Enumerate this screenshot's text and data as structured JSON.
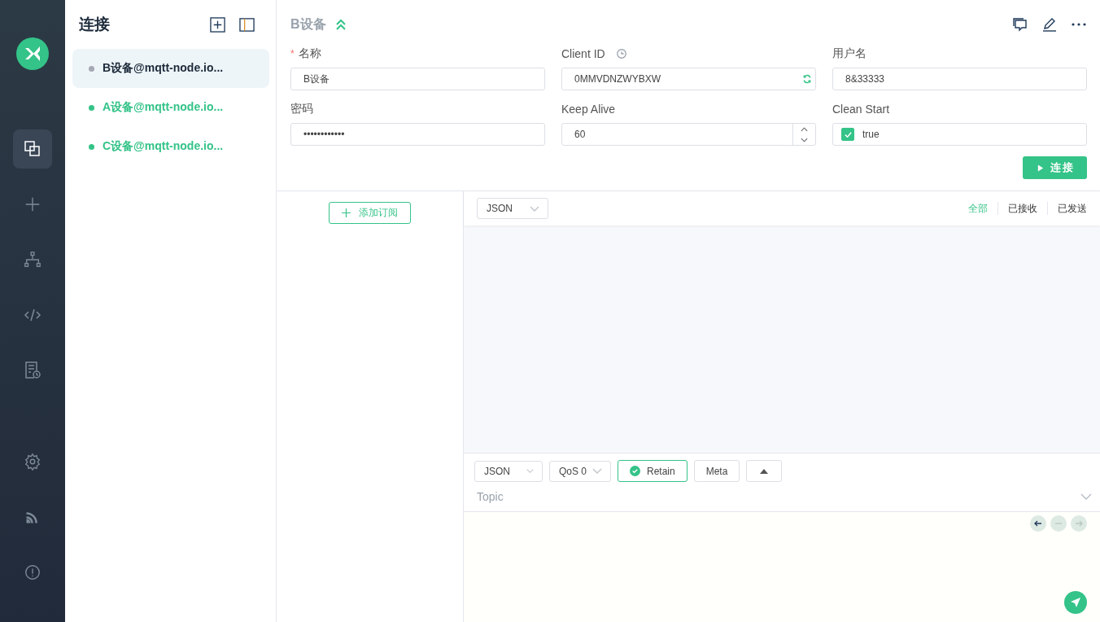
{
  "nav": {
    "items": [
      {
        "kind": "connections",
        "selected": true
      },
      {
        "kind": "new",
        "selected": false
      },
      {
        "kind": "topology",
        "selected": false
      },
      {
        "kind": "script",
        "selected": false
      },
      {
        "kind": "log",
        "selected": false
      }
    ],
    "bottom": [
      {
        "kind": "settings"
      },
      {
        "kind": "feed"
      },
      {
        "kind": "about"
      }
    ]
  },
  "connections": {
    "title": "连接",
    "items": [
      {
        "label": "B设备@mqtt-node.io...",
        "selected": true,
        "connected": false
      },
      {
        "label": "A设备@mqtt-node.io...",
        "selected": false,
        "connected": true
      },
      {
        "label": "C设备@mqtt-node.io...",
        "selected": false,
        "connected": true
      }
    ]
  },
  "header": {
    "title": "B设备"
  },
  "fields": [
    {
      "kind": "text",
      "required_mark": "*",
      "label": "名称",
      "value": "B设备"
    },
    {
      "kind": "client_id",
      "label": "Client ID",
      "value": "0MMVDNZWYBXW"
    },
    {
      "kind": "text",
      "label": "用户名",
      "value": "8&33333"
    },
    {
      "kind": "text",
      "label": "密码",
      "value": "••••••••••••"
    },
    {
      "kind": "number",
      "label": "Keep Alive",
      "value": "60"
    },
    {
      "kind": "checkbox",
      "label": "Clean Start",
      "value": "true",
      "checked": true
    }
  ],
  "connect_button": "连接",
  "add_subscription": "添加订阅",
  "messages": {
    "format": "JSON",
    "filters": [
      {
        "label": "全部",
        "selected": true
      },
      {
        "label": "已接收",
        "selected": false
      },
      {
        "label": "已发送",
        "selected": false
      }
    ]
  },
  "composer": {
    "format": "JSON",
    "qos": "QoS 0",
    "retain": {
      "label": "Retain",
      "checked": true
    },
    "meta": "Meta",
    "topic_placeholder": "Topic"
  }
}
